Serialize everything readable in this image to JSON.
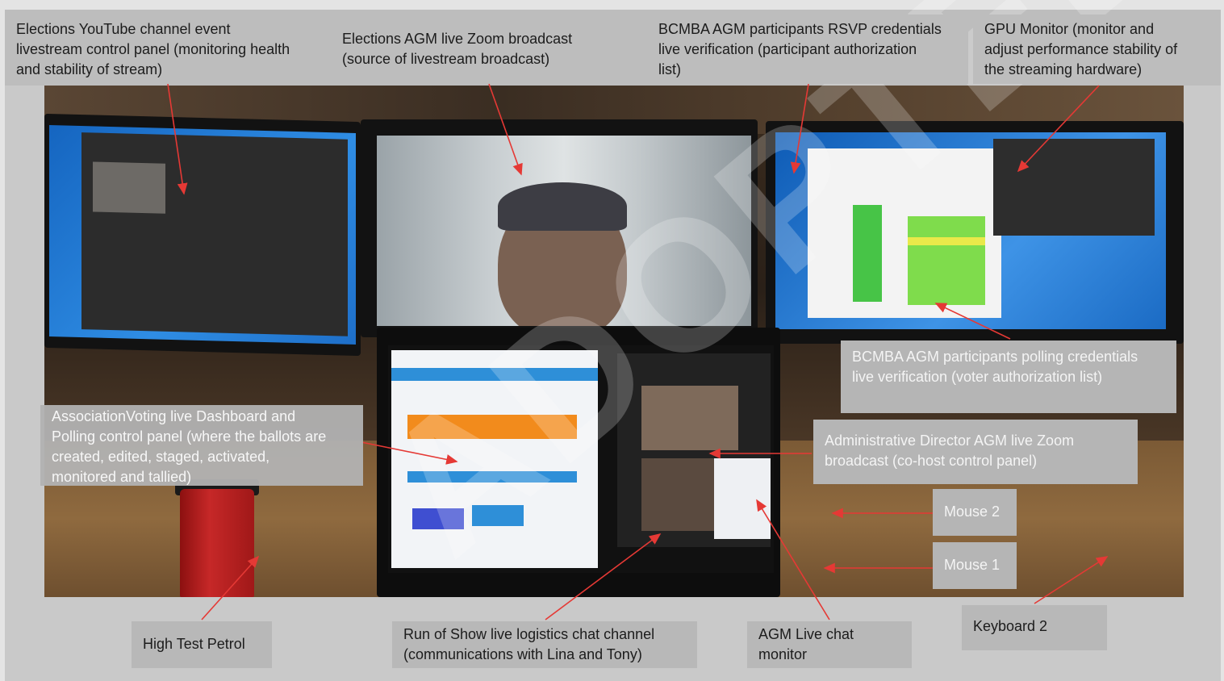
{
  "labels": {
    "youtube_panel": "Elections YouTube channel event\nlivestream control panel (monitoring health\nand stability of stream)",
    "zoom_broadcast": "Elections AGM live Zoom broadcast\n(source of livestream broadcast)",
    "rsvp_verification": "BCMBA AGM participants RSVP credentials\nlive verification (participant authorization\nlist)",
    "gpu_monitor": "GPU Monitor (monitor and\nadjust performance stability of\nthe streaming hardware)",
    "polling_verification": "BCMBA AGM participants polling credentials\nlive verification (voter authorization list)",
    "association_voting": "AssociationVoting live Dashboard and\nPolling control panel (where the ballots are\ncreated, edited, staged, activated,\nmonitored and tallied)",
    "admin_director": "Administrative Director AGM live Zoom\nbroadcast (co-host control panel)",
    "mouse2": "Mouse 2",
    "mouse1": "Mouse 1",
    "keyboard2": "Keyboard 2",
    "high_test_petrol": "High Test Petrol",
    "run_of_show": "Run of Show live logistics chat channel\n(communications with Lina and Tony)",
    "agm_chat": "AGM Live chat\nmonitor"
  },
  "watermark_text": "ADOPTED",
  "colors": {
    "arrow": "#e53935",
    "label_bg": "#bdbdbd"
  }
}
